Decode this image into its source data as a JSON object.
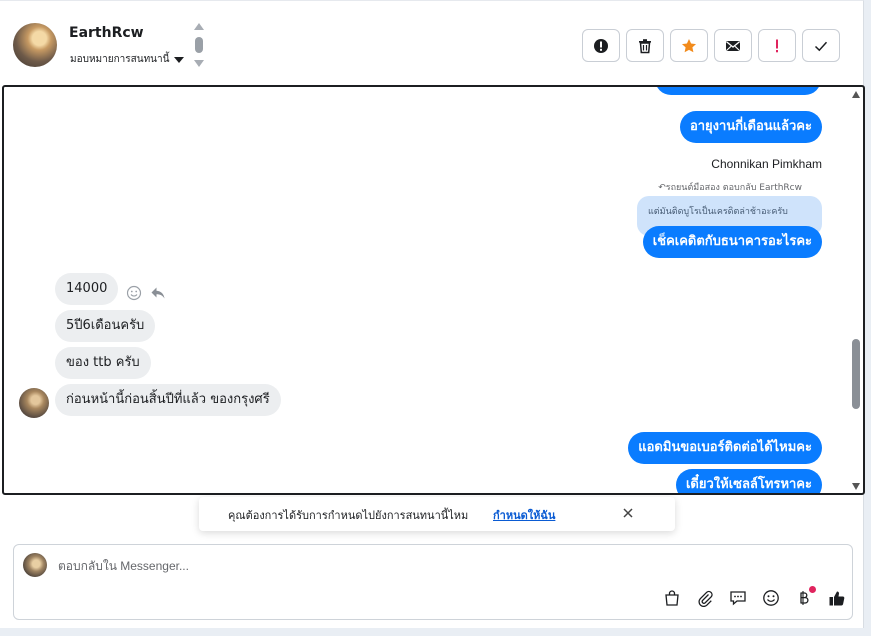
{
  "header": {
    "contact_name": "EarthRcw",
    "assign_label": "มอบหมายการสนทนานี้"
  },
  "actions": [
    {
      "name": "spam-icon"
    },
    {
      "name": "trash-icon"
    },
    {
      "name": "star-icon"
    },
    {
      "name": "mail-icon"
    },
    {
      "name": "important-icon"
    },
    {
      "name": "check-icon"
    }
  ],
  "chat": {
    "out_1": "อายุงานกี่เดือนแล้วคะ",
    "sender_name": "Chonnikan Pimkham",
    "reply_hint": "รถยนต์มือสอง ตอบกลับ EarthRcw",
    "quoted_text": "แต่มันติดบูโรเป็นเครดิตล่าช้าอะครับ",
    "out_2": "เช็คเคดิตกับธนาคารอะไรคะ",
    "in_1": "14000",
    "in_2": "5ปี6เดือนครับ",
    "in_3": "ของ ttb ครับ",
    "in_4": "ก่อนหน้านี้ก่อนสิ้นปีที่แล้ว ของกรุงศรี",
    "out_3": "แอดมินขอเบอร์ติดต่อได้ไหมคะ",
    "out_4": "เดี๋ยวให้เซลล์โทรหาคะ"
  },
  "notification": {
    "text": "คุณต้องการได้รับการกำหนดไปยังการสนทนานี้ไหม",
    "link": "กำหนดให้ฉัน"
  },
  "composer": {
    "placeholder": "ตอบกลับใน Messenger..."
  },
  "colors": {
    "bubble_out": "#0a7cff",
    "bubble_in": "#eceef0",
    "star": "#f28b1c",
    "important": "#e0245e"
  }
}
